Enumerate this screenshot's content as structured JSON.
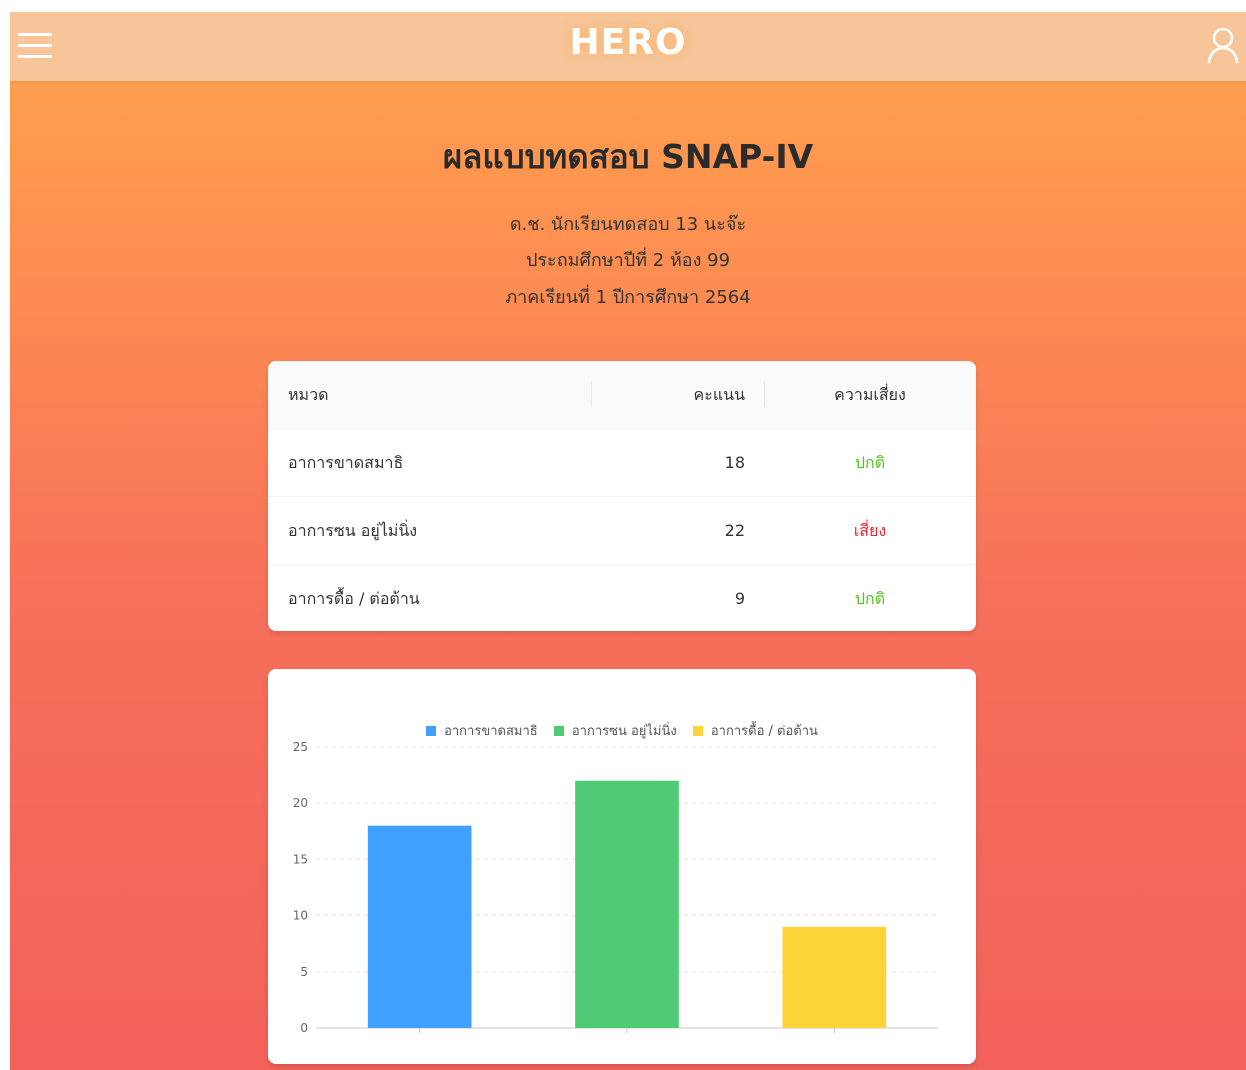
{
  "header": {
    "brand": "HERO",
    "menu_icon": "hamburger-menu-icon",
    "user_icon": "user-icon"
  },
  "page": {
    "title": "ผลแบบทดสอบ SNAP-IV",
    "student_name": "ด.ช. นักเรียนทดสอบ 13 นะจ๊ะ",
    "class_info": "ประถมศึกษาปีที่ 2 ห้อง 99",
    "term_info": "ภาคเรียนที่ 1 ปีการศึกษา 2564"
  },
  "table": {
    "headers": {
      "category": "หมวด",
      "score": "คะแนน",
      "risk": "ความเสี่ยง"
    },
    "rows": [
      {
        "category": "อาการขาดสมาธิ",
        "score": "18",
        "risk": "ปกติ",
        "risk_color": "#52c41a"
      },
      {
        "category": "อาการซน อยู่ไม่นิ่ง",
        "score": "22",
        "risk": "เสี่ยง",
        "risk_color": "#f5222d"
      },
      {
        "category": "อาการดื้อ / ต่อต้าน",
        "score": "9",
        "risk": "ปกติ",
        "risk_color": "#52c41a"
      }
    ]
  },
  "chart_data": {
    "type": "bar",
    "title": "",
    "xlabel": "",
    "ylabel": "",
    "ylim": [
      0,
      25
    ],
    "yticks": [
      0,
      5,
      10,
      15,
      20,
      25
    ],
    "grid": true,
    "legend_position": "top",
    "series": [
      {
        "name": "อาการขาดสมาธิ",
        "value": 18,
        "color": "#3fa0ff"
      },
      {
        "name": "อาการซน อยู่ไม่นิ่ง",
        "value": 22,
        "color": "#4fcb74"
      },
      {
        "name": "อาการดื้อ / ต่อต้าน",
        "value": 9,
        "color": "#fbd437"
      }
    ]
  }
}
